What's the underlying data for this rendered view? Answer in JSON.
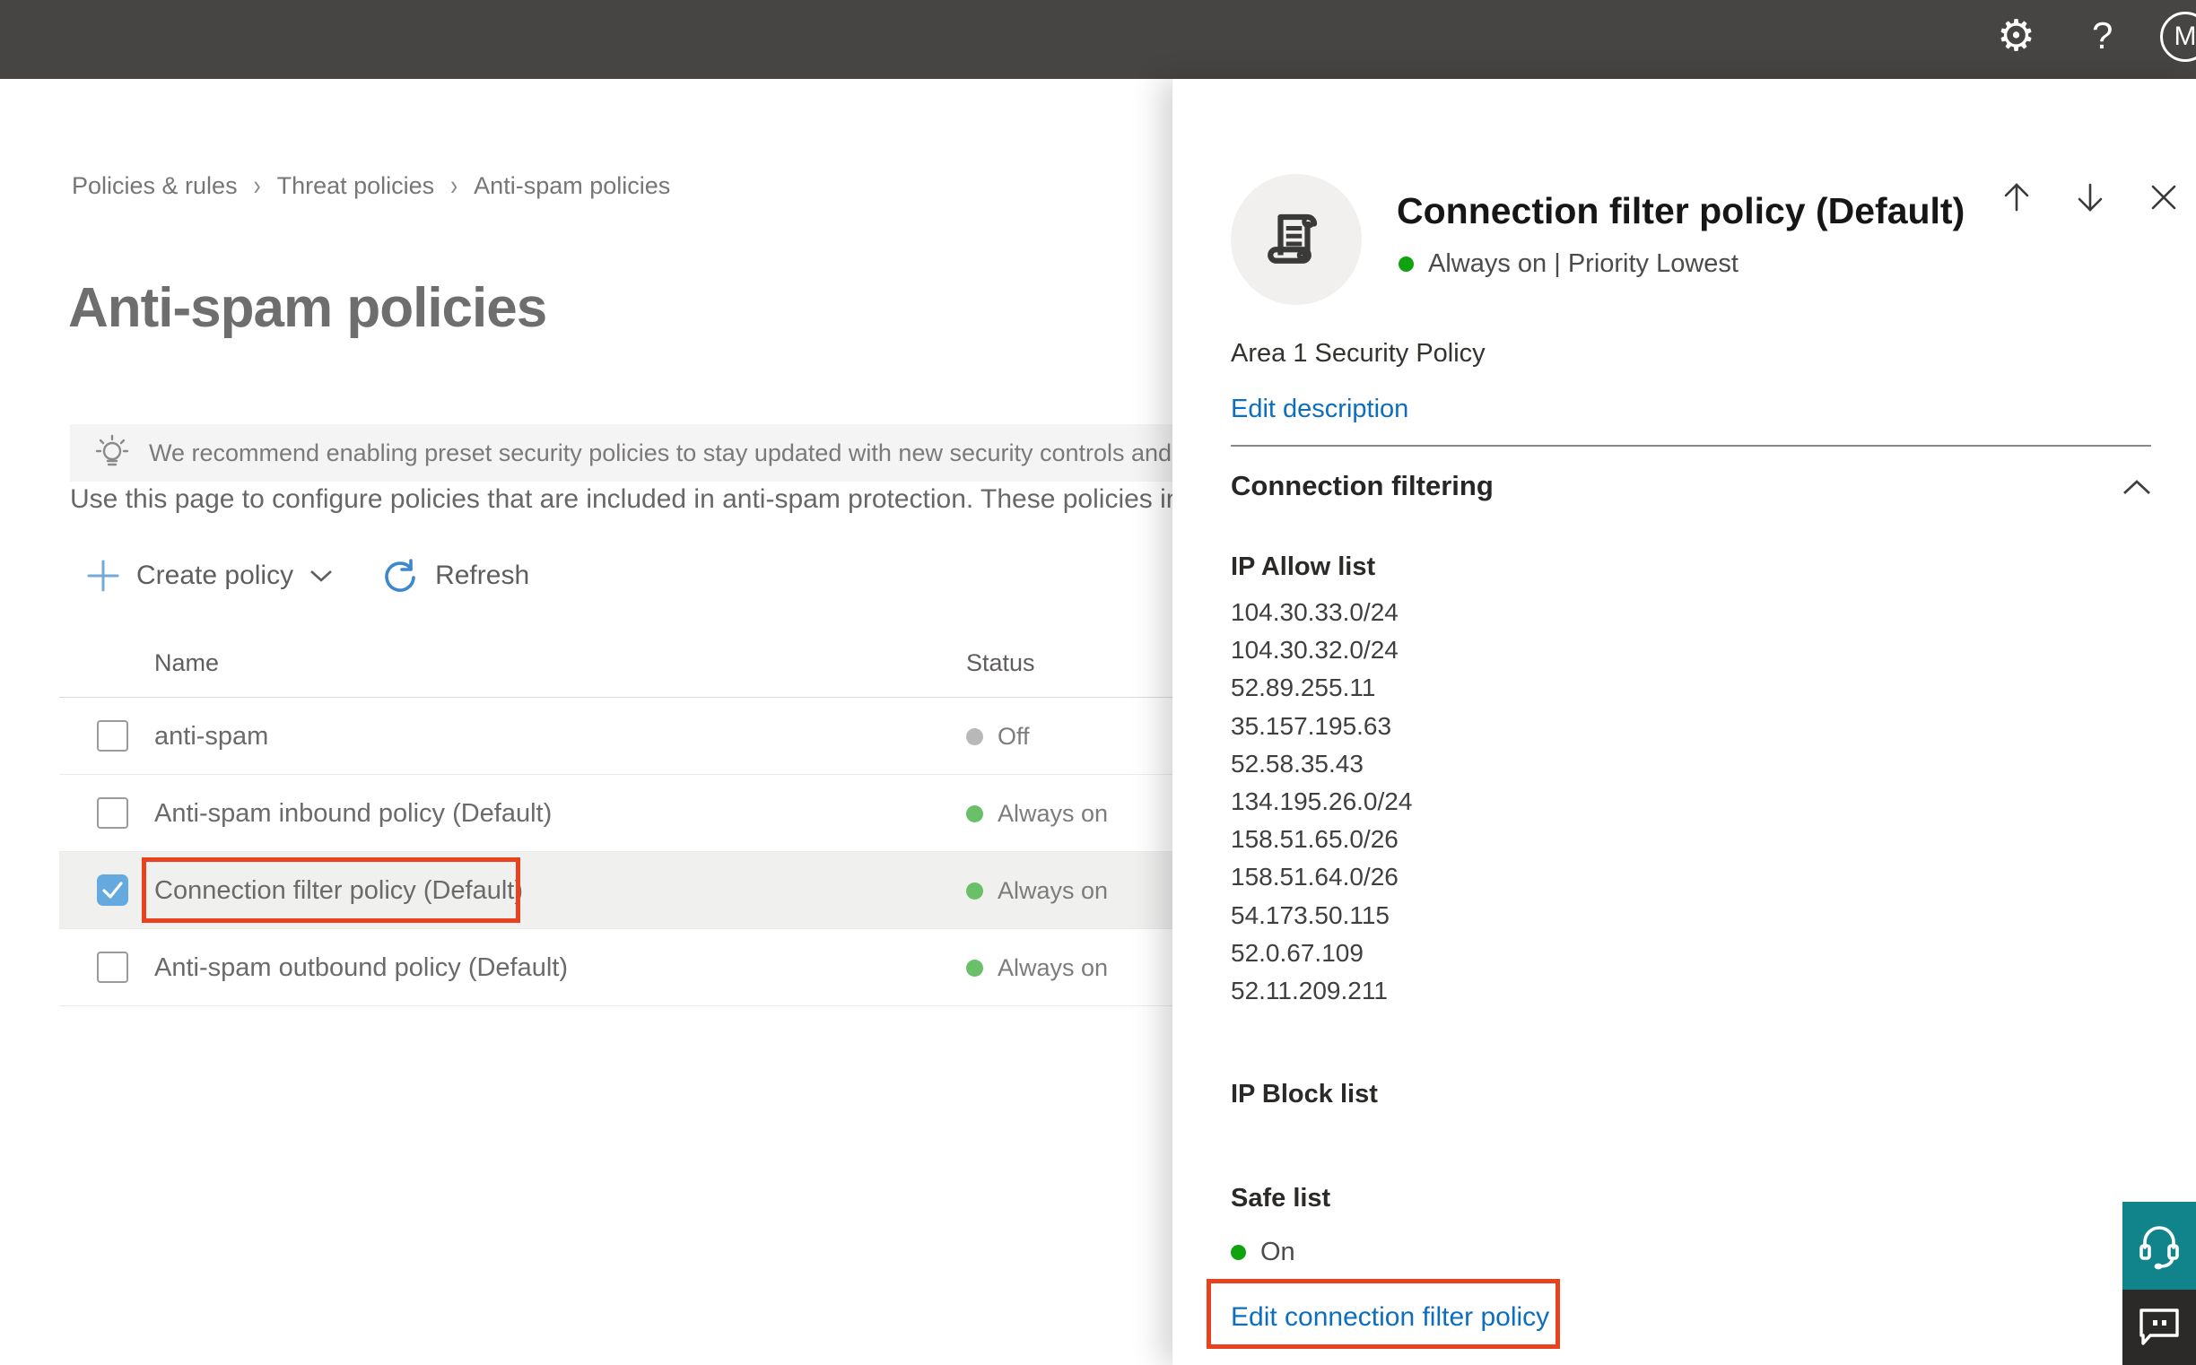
{
  "topbar": {
    "avatar_initial": "M",
    "help_label": "?"
  },
  "breadcrumb": {
    "items": [
      "Policies & rules",
      "Threat policies",
      "Anti-spam policies"
    ],
    "separator": "›"
  },
  "page": {
    "title": "Anti-spam policies",
    "banner_text": "We recommend enabling preset security policies to stay updated with new security controls and our recomme",
    "intro_text": "Use this page to configure policies that are included in anti-spam protection. These policies include"
  },
  "toolbar": {
    "create_policy_label": "Create policy",
    "refresh_label": "Refresh"
  },
  "table": {
    "columns": [
      "Name",
      "Status"
    ],
    "rows": [
      {
        "name": "anti-spam",
        "status": "Off",
        "status_color": "#b8b8b8",
        "checked": false,
        "selected": false,
        "annotated": false
      },
      {
        "name": "Anti-spam inbound policy (Default)",
        "status": "Always on",
        "status_color": "#6abf69",
        "checked": false,
        "selected": false,
        "annotated": false
      },
      {
        "name": "Connection filter policy (Default)",
        "status": "Always on",
        "status_color": "#6abf69",
        "checked": true,
        "selected": true,
        "annotated": true
      },
      {
        "name": "Anti-spam outbound policy (Default)",
        "status": "Always on",
        "status_color": "#6abf69",
        "checked": false,
        "selected": false,
        "annotated": false
      }
    ]
  },
  "panel": {
    "title": "Connection filter policy (Default)",
    "status_text": "Always on | Priority Lowest",
    "description": "Area 1 Security Policy",
    "edit_description_label": "Edit description",
    "section_title": "Connection filtering",
    "ip_allow_title": "IP Allow list",
    "ip_allow_list": [
      "104.30.33.0/24",
      "104.30.32.0/24",
      "52.89.255.11",
      "35.157.195.63",
      "52.58.35.43",
      "134.195.26.0/24",
      "158.51.65.0/26",
      "158.51.64.0/26",
      "54.173.50.115",
      "52.0.67.109",
      "52.11.209.211"
    ],
    "ip_block_title": "IP Block list",
    "safe_list_title": "Safe list",
    "safe_list_status": "On",
    "edit_policy_label": "Edit connection filter policy"
  },
  "colors": {
    "topbar_bg": "#474543",
    "link_blue": "#0e6ebe",
    "annotation_red": "#e8421f",
    "checkbox_checked_blue": "#64aade",
    "status_green_table": "#6abf69",
    "status_green_bright": "#0fa30f",
    "status_gray": "#b8b8b8",
    "help_button_teal": "#11838a",
    "chat_button_dark": "#2b2a28",
    "selected_row_bg": "#f0f0ef"
  }
}
